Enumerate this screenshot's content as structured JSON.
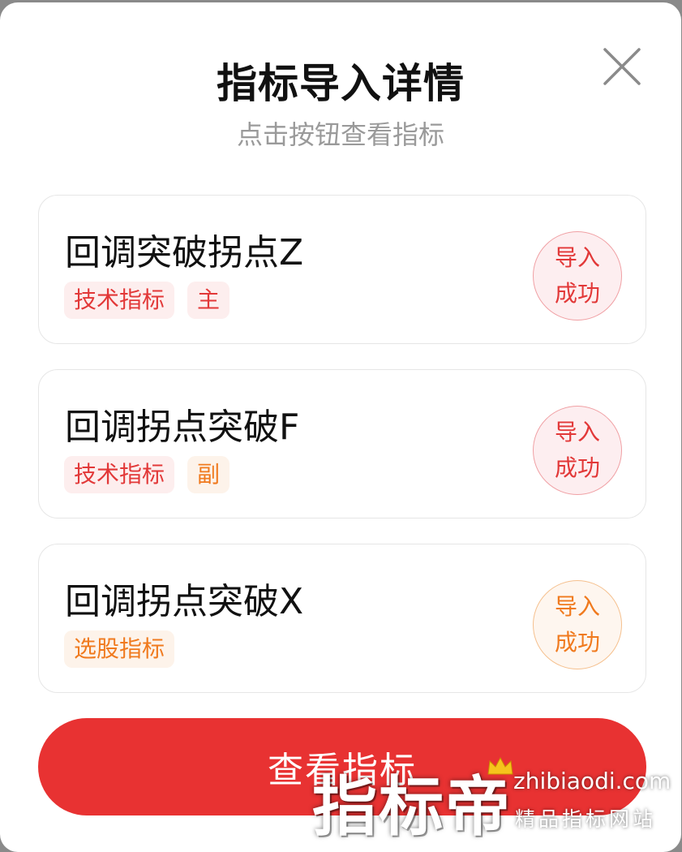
{
  "dialog": {
    "title": "指标导入详情",
    "subtitle": "点击按钮查看指标",
    "close_icon": "close-icon"
  },
  "items": [
    {
      "name": "回调突破拐点Z",
      "tags": [
        {
          "label": "技术指标",
          "tone": "red"
        },
        {
          "label": "主",
          "tone": "red"
        }
      ],
      "status_line1": "导入",
      "status_line2": "成功",
      "status_tone": "red"
    },
    {
      "name": "回调拐点突破F",
      "tags": [
        {
          "label": "技术指标",
          "tone": "red"
        },
        {
          "label": "副",
          "tone": "orange"
        }
      ],
      "status_line1": "导入",
      "status_line2": "成功",
      "status_tone": "red"
    },
    {
      "name": "回调拐点突破X",
      "tags": [
        {
          "label": "选股指标",
          "tone": "orange"
        }
      ],
      "status_line1": "导入",
      "status_line2": "成功",
      "status_tone": "orange"
    }
  ],
  "action": {
    "view_label": "查看指标"
  },
  "watermark": {
    "brand": "指标帝",
    "url": "zhibiaodi.com",
    "slogan": "精品指标网站",
    "icon": "crown-icon"
  },
  "colors": {
    "accent": "#e83232",
    "tag_red": "#e23838",
    "tag_orange": "#f07a1e"
  }
}
